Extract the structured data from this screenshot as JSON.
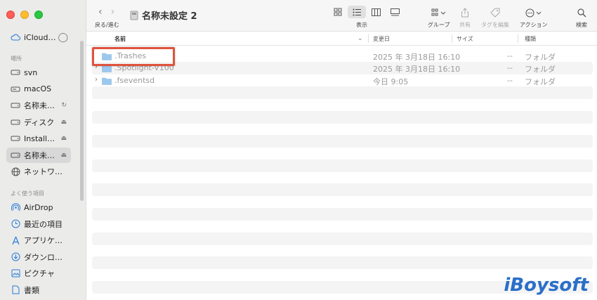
{
  "sidebar": {
    "icloud_label": "iCloud…",
    "section_locations": "場所",
    "section_favorites": "よく使う項目",
    "locations": [
      {
        "label": "svn",
        "icon": "disk-icon",
        "eject": ""
      },
      {
        "label": "macOS",
        "icon": "drive-icon",
        "eject": ""
      },
      {
        "label": "名称未…",
        "icon": "disk-icon",
        "eject": "↻"
      },
      {
        "label": "ディスク",
        "icon": "disk-icon",
        "eject": "⏏"
      },
      {
        "label": "Install…",
        "icon": "disk-icon",
        "eject": "⏏"
      },
      {
        "label": "名称未…",
        "icon": "disk-icon",
        "eject": "⏏"
      },
      {
        "label": "ネットワ…",
        "icon": "globe-icon",
        "eject": ""
      }
    ],
    "favorites": [
      {
        "label": "AirDrop",
        "icon": "airdrop-icon"
      },
      {
        "label": "最近の項目",
        "icon": "clock-icon"
      },
      {
        "label": "アプリケ…",
        "icon": "apps-icon"
      },
      {
        "label": "ダウンロ…",
        "icon": "download-icon"
      },
      {
        "label": "ピクチャ",
        "icon": "photo-icon"
      },
      {
        "label": "書類",
        "icon": "document-icon"
      }
    ]
  },
  "toolbar": {
    "nav_label": "戻る/進む",
    "title": "名称未設定 2",
    "view_label": "表示",
    "group_label": "グループ",
    "share_label": "共有",
    "tag_label": "タグを編集",
    "action_label": "アクション",
    "search_label": "検索"
  },
  "columns": {
    "name": "名前",
    "modified": "変更日",
    "size": "サイズ",
    "kind": "種類"
  },
  "files": [
    {
      "name": ".Trashes",
      "date": "2025 年 3月18日 16:10",
      "size": "--",
      "kind": "フォルダ",
      "expandable": false
    },
    {
      "name": ".Spotlight-V100",
      "date": "2025 年 3月18日 16:10",
      "size": "--",
      "kind": "フォルダ",
      "expandable": true
    },
    {
      "name": ".fseventsd",
      "date": "今日 9:05",
      "size": "--",
      "kind": "フォルダ",
      "expandable": true
    }
  ],
  "watermark": "iBoysoft",
  "colors": {
    "accent": "#2a7bd5",
    "highlight": "#e0533e",
    "folder": "#9cc8ee"
  }
}
